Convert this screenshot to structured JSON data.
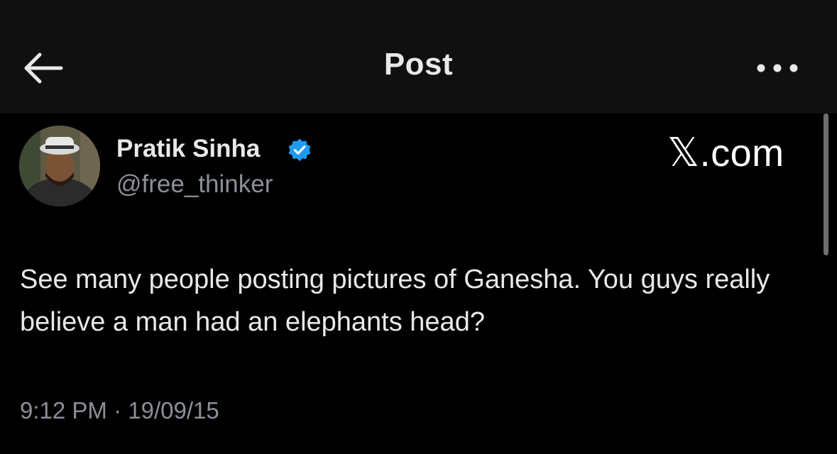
{
  "header": {
    "title": "Post",
    "back_icon": "arrow-left-icon",
    "more_icon": "more-horizontal-icon"
  },
  "post": {
    "author": {
      "name": "Pratik Sinha",
      "handle": "@free_thinker",
      "verified": true,
      "verified_color": "#1d9bf0"
    },
    "text": "See many people posting pictures of Ganesha. You guys really believe a man had an elephants head?",
    "time": "9:12 PM",
    "separator": " · ",
    "date": "19/09/15"
  },
  "watermark": {
    "logo": "𝕏",
    "suffix": ".com"
  },
  "colors": {
    "background": "#000000",
    "header_background": "#101010",
    "primary_text": "#e7e9ea",
    "secondary_text": "#8b9097"
  }
}
